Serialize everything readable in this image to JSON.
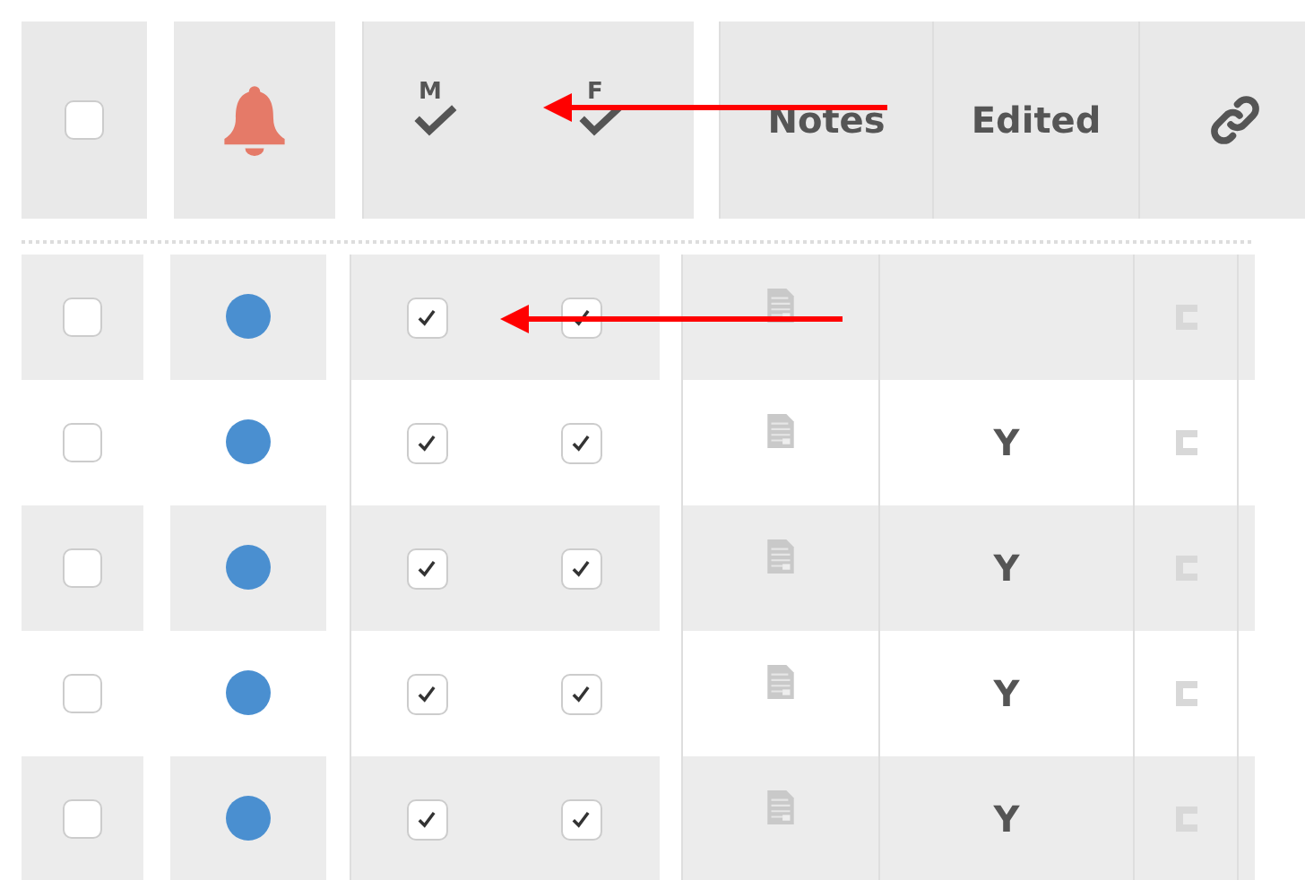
{
  "header": {
    "select_all": {
      "checked": false
    },
    "alert_column": {
      "kind": "bell"
    },
    "check_columns": [
      {
        "letter": "M"
      },
      {
        "letter": "F"
      }
    ],
    "text_columns": [
      "Notes",
      "Edited"
    ],
    "link_column": {
      "kind": "link"
    }
  },
  "rows": [
    {
      "selected": false,
      "color": "#4a8fd0",
      "m_checked": true,
      "f_checked": true
    },
    {
      "selected": false,
      "color": "#4a8fd0",
      "m_checked": true,
      "f_checked": true,
      "edited": "Y"
    },
    {
      "selected": false,
      "color": "#4a8fd0",
      "m_checked": true,
      "f_checked": true,
      "edited": "Y"
    },
    {
      "selected": false,
      "color": "#4a8fd0",
      "m_checked": true,
      "f_checked": true,
      "edited": "Y"
    },
    {
      "selected": false,
      "color": "#4a8fd0",
      "m_checked": true,
      "f_checked": true,
      "edited": "Y"
    }
  ],
  "annotations": [
    {
      "kind": "arrow"
    },
    {
      "kind": "arrow"
    }
  ]
}
